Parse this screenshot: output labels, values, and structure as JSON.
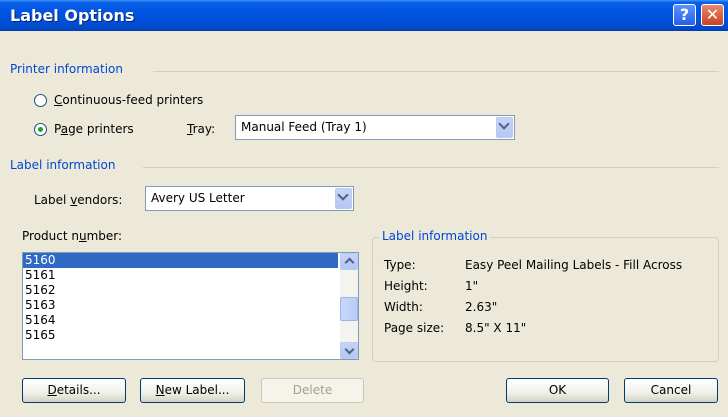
{
  "window": {
    "title": "Label Options",
    "help_symbol": "?",
    "close_symbol": "✕"
  },
  "printer_info": {
    "header": "Printer information",
    "continuous_pre": "",
    "continuous_u": "C",
    "continuous_post": "ontinuous-feed printers",
    "page_pre": "P",
    "page_u": "a",
    "page_post": "ge printers",
    "tray_u": "T",
    "tray_post": "ray:",
    "tray_value": "Manual Feed (Tray 1)",
    "selected": "page"
  },
  "label_info": {
    "header": "Label information",
    "vendors_pre": "Label ",
    "vendors_u": "v",
    "vendors_post": "endors:",
    "vendor_value": "Avery US Letter"
  },
  "product": {
    "label_pre": "Product n",
    "label_u": "u",
    "label_post": "mber:",
    "items": [
      "5160",
      "5161",
      "5162",
      "5163",
      "5164",
      "5165"
    ],
    "selected_index": 0
  },
  "details_group": {
    "title": "Label information",
    "rows": [
      {
        "label": "Type:",
        "value": "Easy Peel Mailing Labels - Fill Across"
      },
      {
        "label": "Height:",
        "value": "1\""
      },
      {
        "label": "Width:",
        "value": "2.63\""
      },
      {
        "label": "Page size:",
        "value": "8.5\" X 11\""
      }
    ]
  },
  "buttons": {
    "details_u": "D",
    "details_post": "etails...",
    "new_label_u": "N",
    "new_label_post": "ew Label...",
    "delete": "Delete",
    "ok": "OK",
    "cancel": "Cancel"
  },
  "colors": {
    "title_bar": "#0054e3",
    "section_header": "#0046d5",
    "selection": "#316ac5",
    "dialog_bg": "#ece9d8"
  }
}
